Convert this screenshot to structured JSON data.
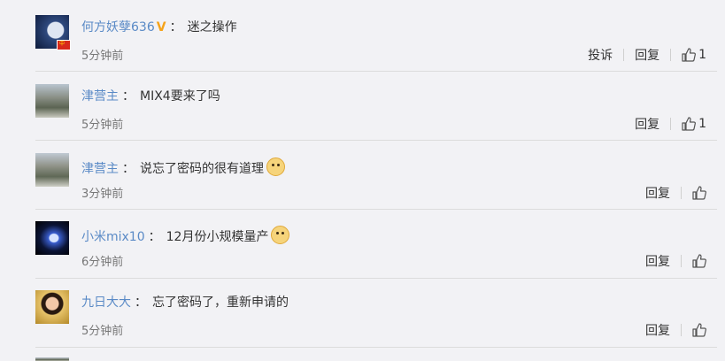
{
  "comments": [
    {
      "username": "何方妖孽636",
      "verified": true,
      "separator": "：",
      "text": "迷之操作",
      "emoji": false,
      "time": "5分钟前",
      "report": "投诉",
      "reply": "回复",
      "likes": "1",
      "flag": "中"
    },
    {
      "username": "津营主",
      "verified": false,
      "separator": "：",
      "text": "MIX4要来了吗",
      "emoji": false,
      "time": "5分钟前",
      "reply": "回复",
      "likes": "1"
    },
    {
      "username": "津营主",
      "verified": false,
      "separator": "：",
      "text": "说忘了密码的很有道理",
      "emoji": true,
      "time": "3分钟前",
      "reply": "回复"
    },
    {
      "username": "小米mix10",
      "verified": false,
      "separator": "：",
      "text": "12月份小规模量产",
      "emoji": true,
      "time": "6分钟前",
      "reply": "回复"
    },
    {
      "username": "九日大大",
      "verified": false,
      "separator": "：",
      "text": "忘了密码了，重新申请的",
      "emoji": false,
      "time": "5分钟前",
      "reply": "回复"
    }
  ],
  "colors": {
    "username": "#5a8ac6",
    "verified": "#f5a31a",
    "background": "#f2f2f5"
  }
}
